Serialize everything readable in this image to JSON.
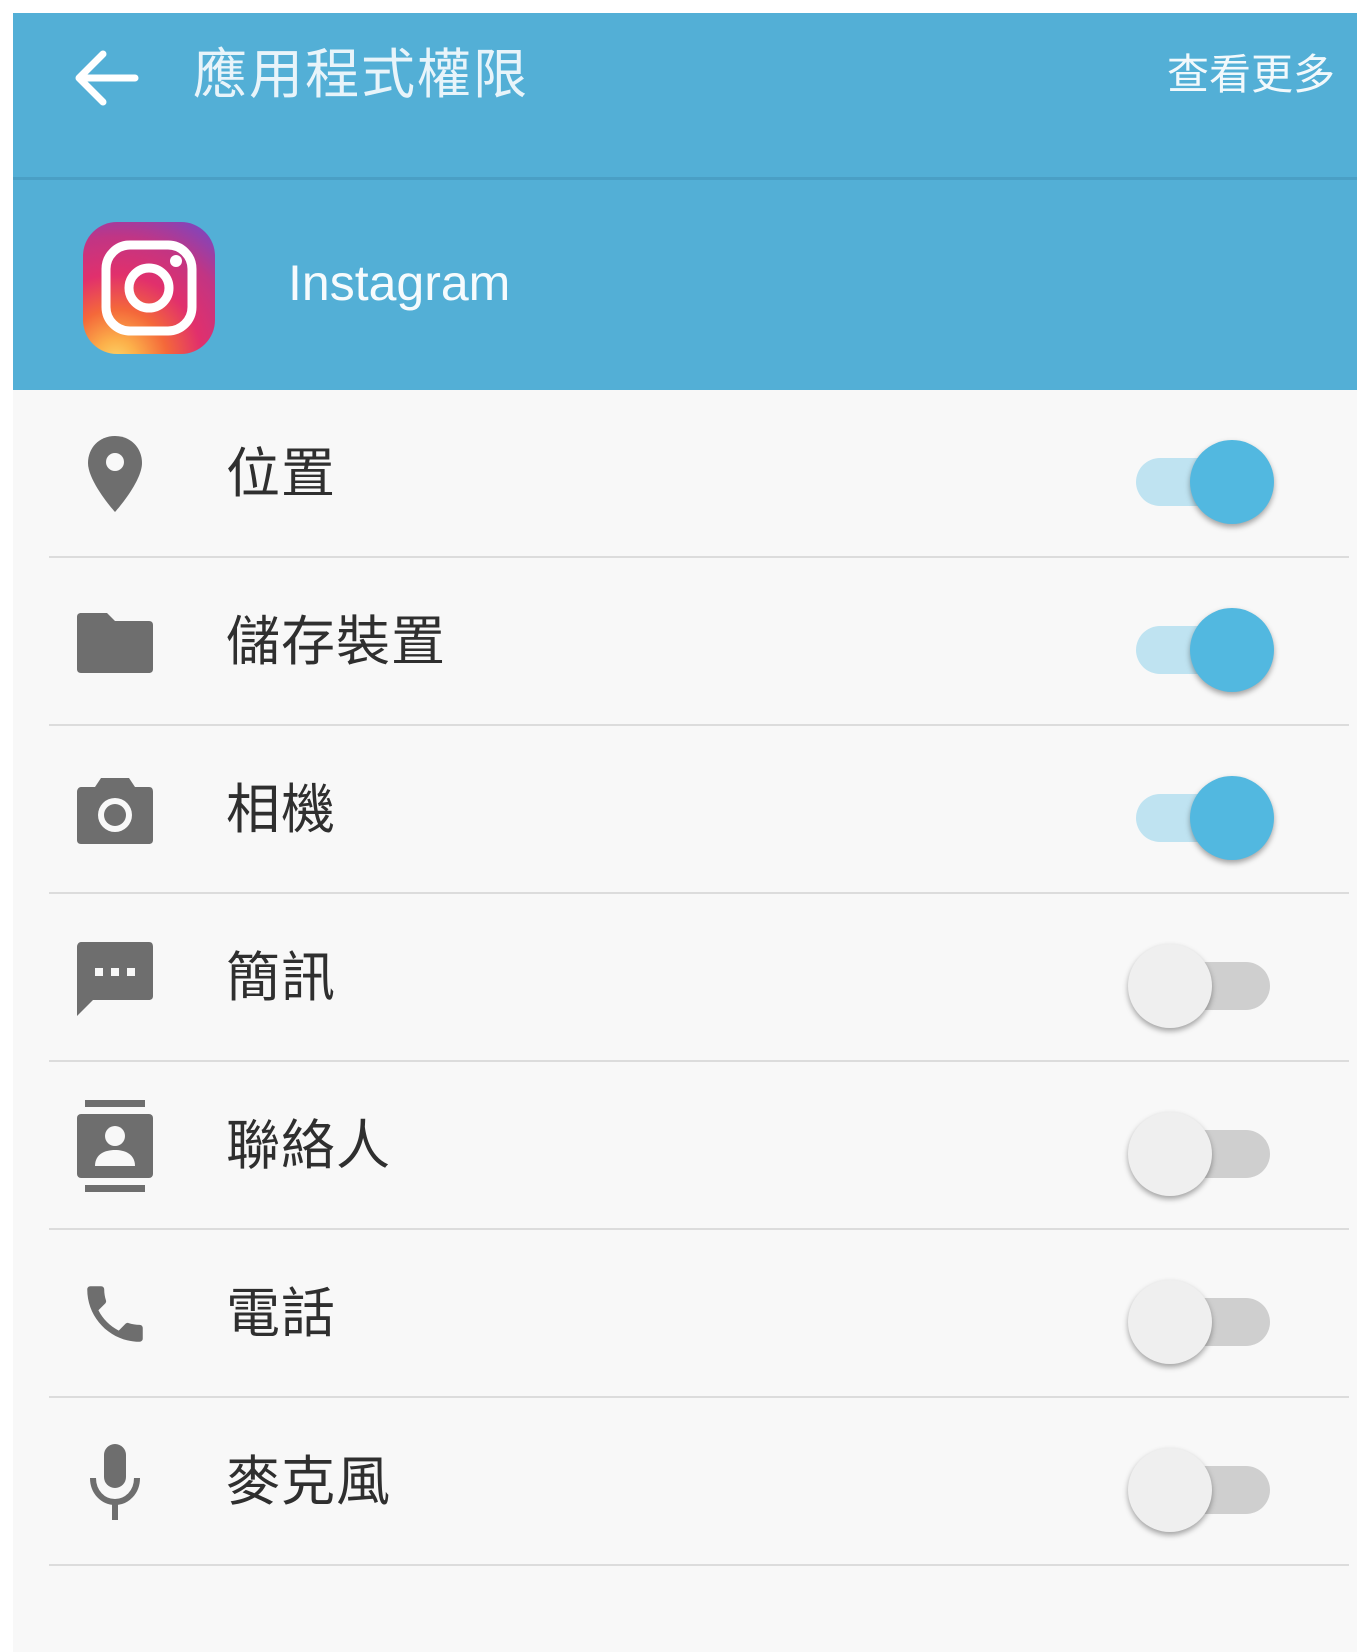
{
  "toolbar": {
    "title": "應用程式權限",
    "more_label": "查看更多",
    "back_icon": "arrow-left-icon"
  },
  "app": {
    "name": "Instagram",
    "icon": "instagram-logo-icon"
  },
  "colors": {
    "toolbar_bg": "#53afd6",
    "switch_on": "#52b8e0",
    "switch_on_track": "#bfe3f1",
    "switch_off": "#efefef",
    "switch_off_track": "#cfcfcf",
    "icon_gray": "#6e6e6e"
  },
  "permissions": [
    {
      "label": "位置",
      "icon": "location-pin-icon",
      "enabled": true
    },
    {
      "label": "儲存裝置",
      "icon": "folder-icon",
      "enabled": true
    },
    {
      "label": "相機",
      "icon": "camera-icon",
      "enabled": true
    },
    {
      "label": "簡訊",
      "icon": "sms-icon",
      "enabled": false
    },
    {
      "label": "聯絡人",
      "icon": "contacts-icon",
      "enabled": false
    },
    {
      "label": "電話",
      "icon": "phone-icon",
      "enabled": false
    },
    {
      "label": "麥克風",
      "icon": "microphone-icon",
      "enabled": false
    }
  ]
}
